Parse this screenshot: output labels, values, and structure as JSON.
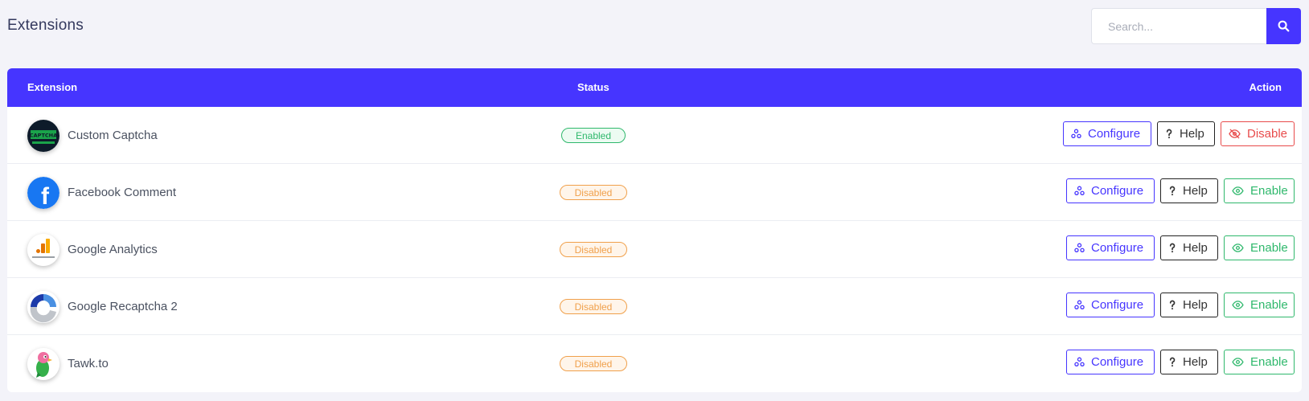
{
  "page": {
    "title": "Extensions"
  },
  "search": {
    "placeholder": "Search..."
  },
  "table": {
    "columns": {
      "extension": "Extension",
      "status": "Status",
      "action": "Action"
    },
    "rows": [
      {
        "name": "Custom Captcha",
        "status": "Enabled",
        "logo": "captcha-logo",
        "logo_text": "CAPTCHA",
        "toggle_label": "Disable"
      },
      {
        "name": "Facebook Comment",
        "status": "Disabled",
        "logo": "facebook-logo",
        "logo_text": "f",
        "toggle_label": "Enable"
      },
      {
        "name": "Google Analytics",
        "status": "Disabled",
        "logo": "google-analytics-logo",
        "toggle_label": "Enable"
      },
      {
        "name": "Google Recaptcha 2",
        "status": "Disabled",
        "logo": "recaptcha-logo",
        "toggle_label": "Enable"
      },
      {
        "name": "Tawk.to",
        "status": "Disabled",
        "logo": "tawkto-logo",
        "toggle_label": "Enable"
      }
    ]
  },
  "buttons": {
    "configure": "Configure",
    "help": "Help"
  },
  "colors": {
    "accent": "#4635ff",
    "enabled": "#2fb86c",
    "disabled": "#f0a04b",
    "danger": "#e84b4b",
    "background": "#f3f3f9"
  }
}
